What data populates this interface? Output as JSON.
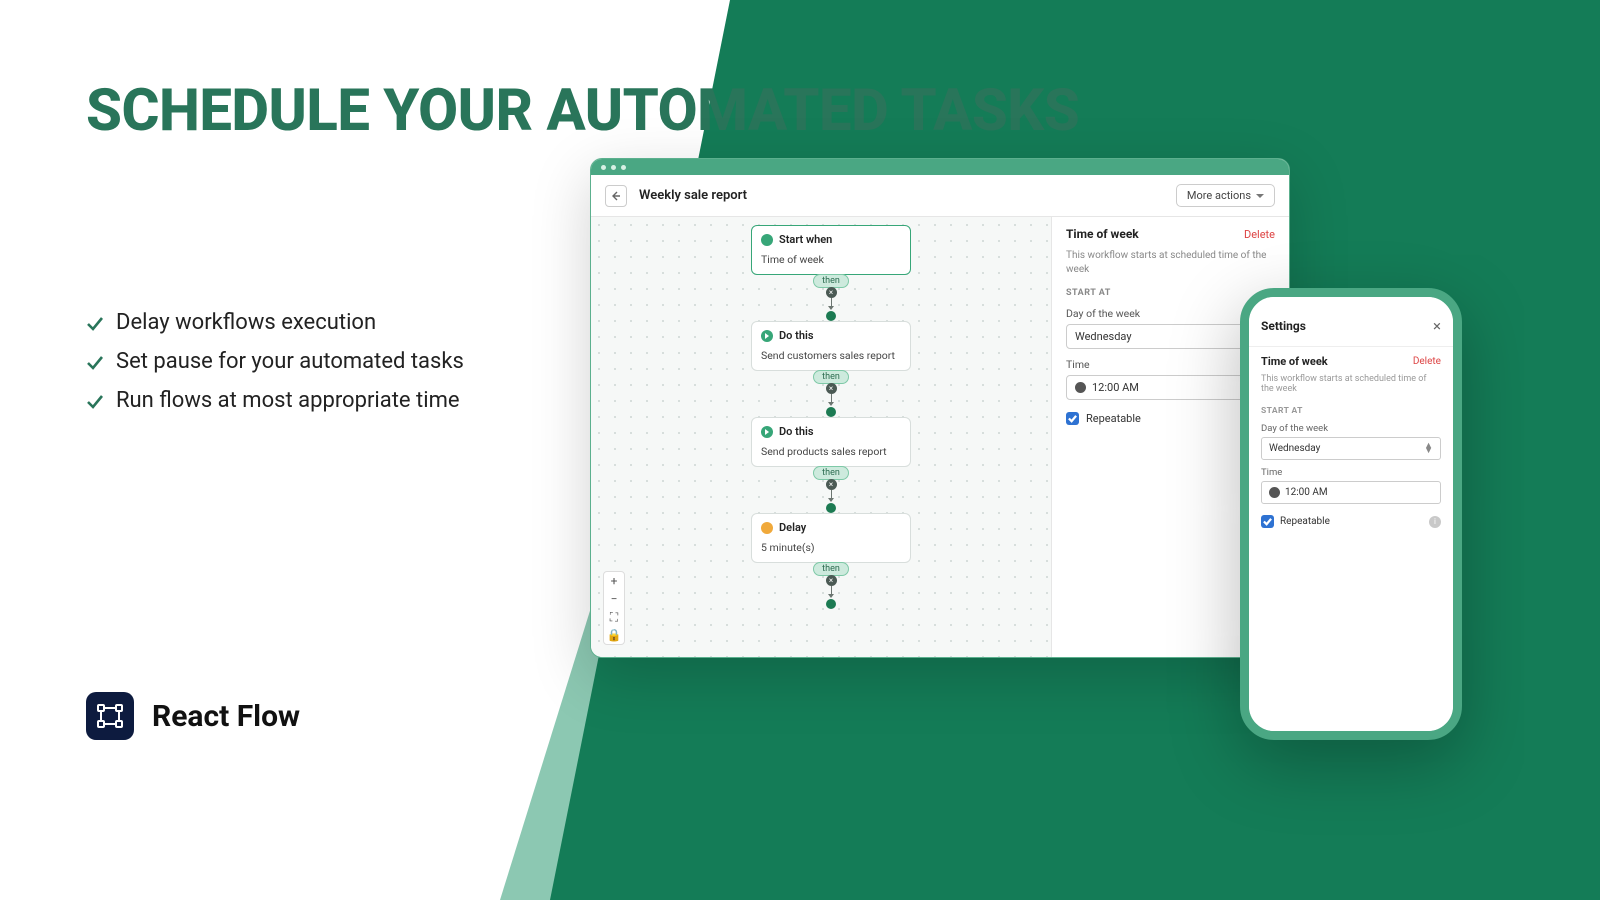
{
  "marketing": {
    "headline": "SCHEDULE YOUR AUTOMATED TASKS",
    "bullets": [
      "Delay workflows execution",
      "Set pause for your automated tasks",
      "Run flows at most appropriate time"
    ],
    "brand": "React Flow"
  },
  "window": {
    "title": "Weekly sale report",
    "more_actions": "More actions",
    "flow": {
      "start": {
        "head": "Start when",
        "sub": "Time of week"
      },
      "step1": {
        "head": "Do this",
        "sub": "Send customers sales report"
      },
      "step2": {
        "head": "Do this",
        "sub": "Send products sales report"
      },
      "delay": {
        "head": "Delay",
        "sub": "5 minute(s)"
      },
      "then": "then"
    },
    "panel": {
      "title": "Time of week",
      "delete": "Delete",
      "desc": "This workflow starts at scheduled time of the week",
      "section": "START AT",
      "day_label": "Day of the week",
      "day_value": "Wednesday",
      "time_label": "Time",
      "time_value": "12:00 AM",
      "repeatable": "Repeatable"
    }
  },
  "phone": {
    "top": "Settings",
    "panel": {
      "title": "Time of week",
      "delete": "Delete",
      "desc": "This workflow starts at scheduled time of the week",
      "section": "START AT",
      "day_label": "Day of the week",
      "day_value": "Wednesday",
      "time_label": "Time",
      "time_value": "12:00 AM",
      "repeatable": "Repeatable"
    }
  }
}
